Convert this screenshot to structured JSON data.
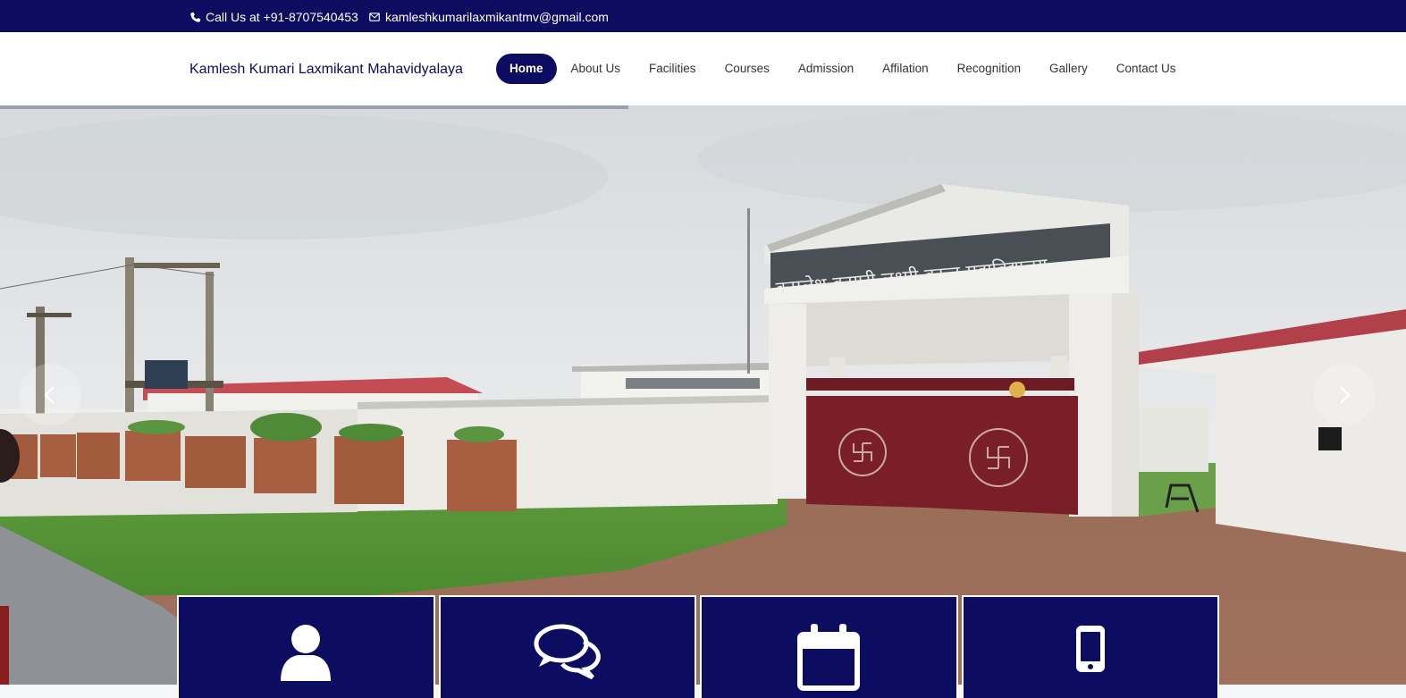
{
  "topbar": {
    "phone_icon": "phone-icon",
    "phone_text": "Call Us at +91-8707540453",
    "email_icon": "envelope-icon",
    "email_text": "kamleshkumarilaxmikantmv@gmail.com"
  },
  "header": {
    "brand": "Kamlesh Kumari Laxmikant Mahavidyalaya",
    "nav": [
      {
        "label": "Home",
        "active": true
      },
      {
        "label": "About Us"
      },
      {
        "label": "Facilities"
      },
      {
        "label": "Courses"
      },
      {
        "label": "Admission"
      },
      {
        "label": "Affilation"
      },
      {
        "label": "Recognition"
      },
      {
        "label": "Gallery"
      },
      {
        "label": "Contact Us"
      }
    ]
  },
  "slider": {
    "gate_sign": "कमलेश कुमारी लक्ष्मी कान्त महाविद्यालय",
    "prev_icon": "chevron-left-icon",
    "next_icon": "chevron-right-icon"
  },
  "features": [
    {
      "icon": "user-icon"
    },
    {
      "icon": "chat-bubbles-icon"
    },
    {
      "icon": "calendar-icon"
    },
    {
      "icon": "mobile-phone-icon"
    }
  ],
  "colors": {
    "brand_navy": "#0c0c60",
    "gate_red": "#7a1f27"
  }
}
